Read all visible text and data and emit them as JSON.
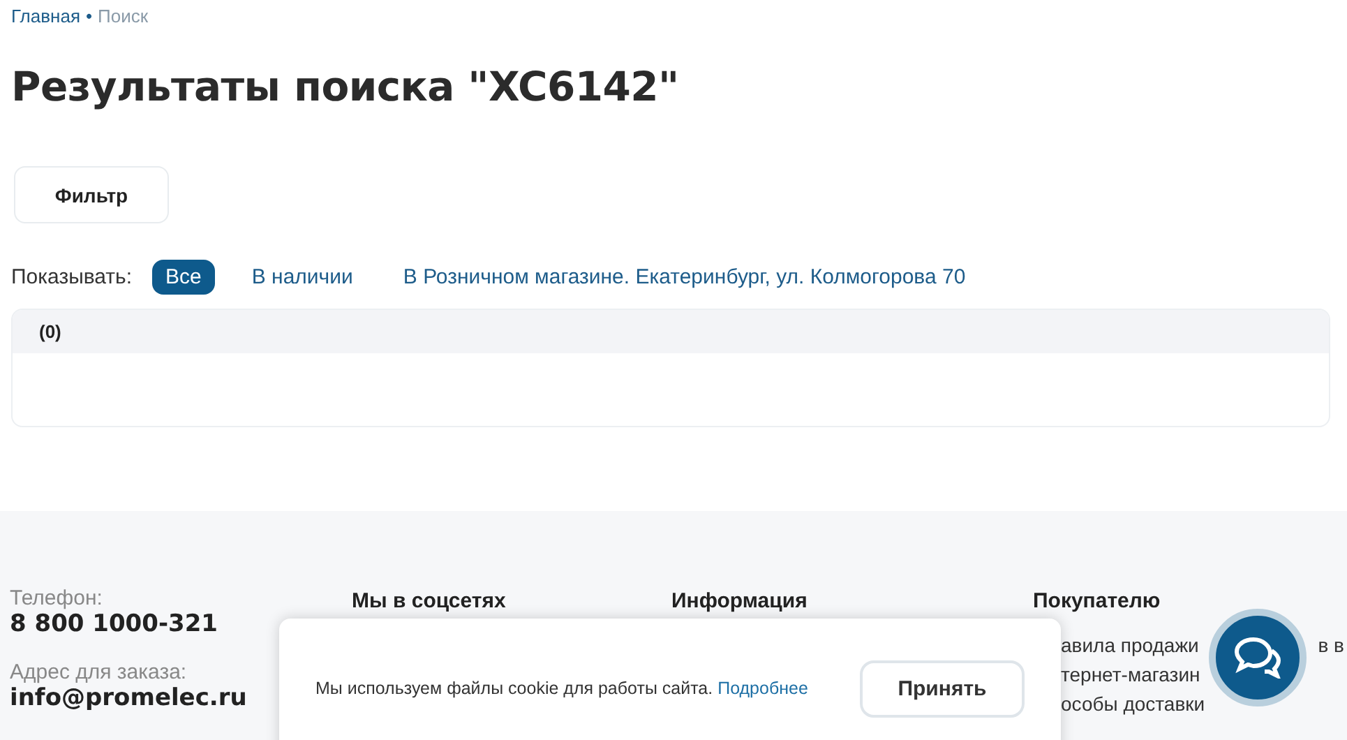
{
  "breadcrumb": [
    {
      "label": "Главная",
      "current": false
    },
    {
      "label": "Поиск",
      "current": true
    }
  ],
  "breadcrumb_separator": "•",
  "title": "Результаты поиска \"XC6142\"",
  "filter_button": "Фильтр",
  "show": {
    "label": "Показывать:",
    "options": [
      {
        "label": "Все",
        "selected": true
      },
      {
        "label": "В наличии",
        "selected": false
      },
      {
        "label": "В Розничном магазине. Екатеринбург, ул. Колмогорова 70",
        "selected": false
      }
    ]
  },
  "results": {
    "count": "(0)"
  },
  "footer": {
    "phone_label": "Телефон:",
    "phone": "8 800 1000-321",
    "email_label": "Адрес для заказа:",
    "email": "info@promelec.ru",
    "social_heading": "Мы в соцсетях",
    "info_heading": "Информация",
    "buyer_heading": "Покупателю",
    "buyer_links": [
      {
        "parts": [
          "авила продажи",
          "в в"
        ]
      },
      {
        "parts": [
          "тернет-магазин"
        ]
      },
      {
        "parts": [
          "особы доставки"
        ]
      }
    ]
  },
  "cookie_banner": {
    "text": "Мы используем файлы cookie для работы сайта.",
    "link": "Подробнее",
    "button": "Принять"
  }
}
